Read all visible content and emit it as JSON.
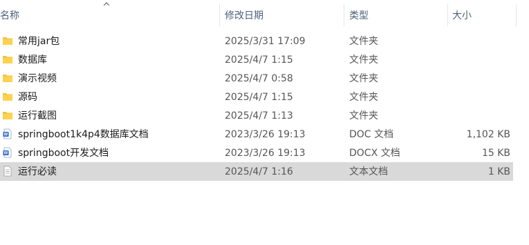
{
  "columns": {
    "name": "名称",
    "date": "修改日期",
    "type": "类型",
    "size": "大小"
  },
  "files": [
    {
      "name": "常用jar包",
      "date": "2025/3/31 17:09",
      "type": "文件夹",
      "size": "",
      "icon": "folder-icon"
    },
    {
      "name": "数据库",
      "date": "2025/4/7 1:15",
      "type": "文件夹",
      "size": "",
      "icon": "folder-icon"
    },
    {
      "name": "演示视频",
      "date": "2025/4/7 0:58",
      "type": "文件夹",
      "size": "",
      "icon": "folder-icon"
    },
    {
      "name": "源码",
      "date": "2025/4/7 1:15",
      "type": "文件夹",
      "size": "",
      "icon": "folder-icon"
    },
    {
      "name": "运行截图",
      "date": "2025/4/7 1:13",
      "type": "文件夹",
      "size": "",
      "icon": "folder-icon"
    },
    {
      "name": "springboot1k4p4数据库文档",
      "date": "2023/3/26 19:13",
      "type": "DOC 文档",
      "size": "1,102 KB",
      "icon": "word-doc-icon"
    },
    {
      "name": "springboot开发文档",
      "date": "2023/3/26 19:13",
      "type": "DOCX 文档",
      "size": "15 KB",
      "icon": "word-doc-icon"
    },
    {
      "name": "运行必读",
      "date": "2025/4/7 1:16",
      "type": "文本文档",
      "size": "1 KB",
      "icon": "text-file-icon",
      "selected": true
    }
  ]
}
